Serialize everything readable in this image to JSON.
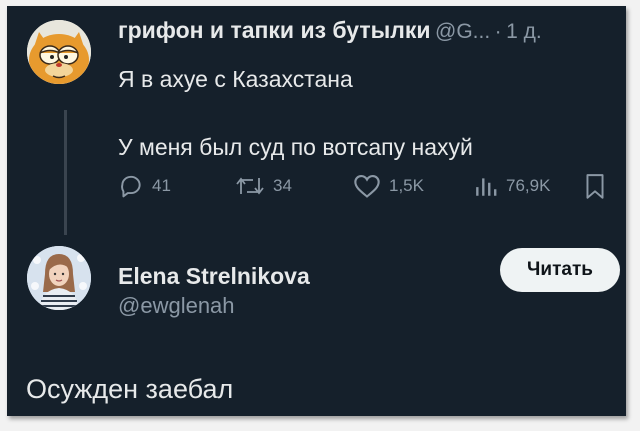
{
  "tweet": {
    "author_name": "грифон и тапки из бутылки",
    "handle": "@G...",
    "separator": "·",
    "time": "1 д.",
    "line1": "Я в ахуе с Казахстана",
    "line2": "У меня был суд по вотсапу нахуй",
    "actions": {
      "replies": "41",
      "retweets": "34",
      "likes": "1,5K",
      "views": "76,9K"
    },
    "icons": [
      "reply-icon",
      "retweet-icon",
      "like-icon",
      "views-icon",
      "bookmark-icon"
    ]
  },
  "user_card": {
    "name": "Elena Strelnikova",
    "handle": "@ewglenah",
    "follow_label": "Читать"
  },
  "caption": "Осужден заебал",
  "colors": {
    "background": "#15202b",
    "text": "#e7e9ea",
    "muted": "#8b98a5",
    "button_bg": "#eff3f4"
  }
}
